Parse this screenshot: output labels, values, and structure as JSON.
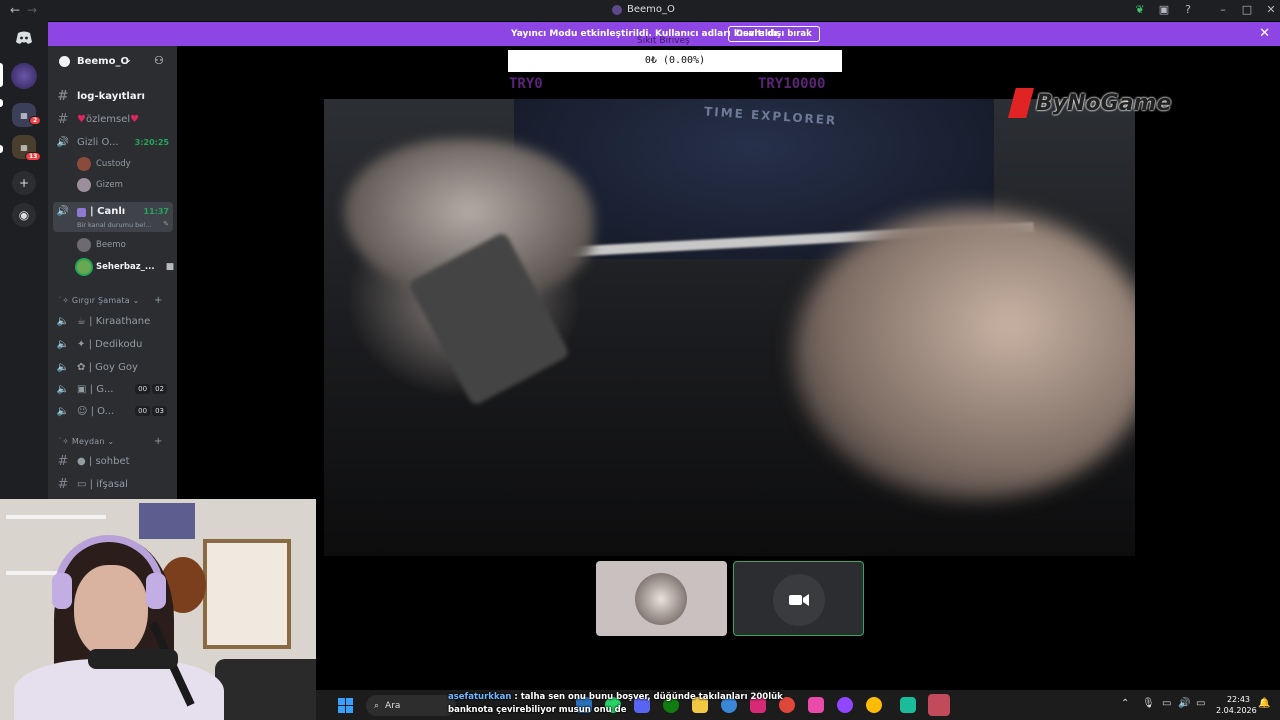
{
  "window": {
    "title": "Beemo_O",
    "back_icon": "←",
    "forward_icon": "→",
    "tools": [
      "leaf-icon",
      "inbox-icon",
      "help-icon"
    ],
    "minimize": "–",
    "maximize": "□",
    "close": "✕"
  },
  "banner": {
    "message": "Yayıncı Modu etkinleştirildi. Kullanıcı adları kısaltıldı.",
    "button": "Devre dışı bırak",
    "close": "✕"
  },
  "rail": {
    "badges": [
      "2",
      "13"
    ]
  },
  "server": {
    "name": "Beemo_O",
    "chevron": "⌄",
    "invite_icon": "👤+"
  },
  "channels": {
    "log": "log-kayıtları",
    "ozlemsel": "özlemsel",
    "voice1": {
      "name": "Gizli O...",
      "time": "3:20:25",
      "users": [
        "Custody",
        "Gizem"
      ]
    },
    "voice2": {
      "name": "| Canlı",
      "time": "11:37",
      "status": "Bir kanal durumu bel...",
      "users": [
        "Beemo",
        "Seherbaz_..."
      ]
    },
    "category1": "Gırgır Şamata",
    "kiraathane": "| Kıraathane",
    "dedikodu": "| Dedikodu",
    "goygoy": "| Goy Goy",
    "g_channel": {
      "name": "| G...",
      "counts": [
        "00",
        "02"
      ]
    },
    "o_channel": {
      "name": "| Ö...",
      "counts": [
        "00",
        "03"
      ]
    },
    "category2": "Meydan",
    "sohbet": "| sohbet",
    "ifsasal": "| ifşasal"
  },
  "stream": {
    "ticker_top": "Sıkıt Bırıveş",
    "progress": "0₺ (0.00%)",
    "progress_value": 0,
    "try_left": "TRY0",
    "try_right": "TRY10000",
    "watermark": "ByNoGame",
    "shirt_text": "TIME EXPLORER"
  },
  "taskbar": {
    "search": "Ara",
    "time": "22:43",
    "date": "2.04.2026"
  },
  "chat": {
    "nick": "asefaturkkan",
    "message": ": talha sen onu bunu boşver, düğünde takılanları 200lük banknota çevirebiliyor musun onu de"
  },
  "colors": {
    "accent": "#8d45e3",
    "discord_dark": "#1e1f22",
    "sidebar": "#2b2d31",
    "voice_green": "#23a55a"
  }
}
